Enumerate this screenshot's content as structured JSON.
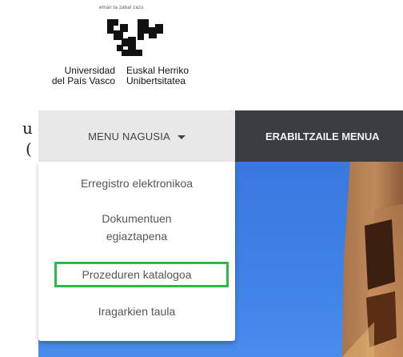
{
  "logo": {
    "tagline": "eman ta zabal zazu",
    "name_es": [
      "Universidad",
      "del País Vasco"
    ],
    "name_eu": [
      "Euskal Herriko",
      "Unibertsitatea"
    ]
  },
  "background_text": [
    "u",
    "("
  ],
  "nav": {
    "main_menu_label": "MENU NAGUSIA",
    "user_menu_label": "ERABILTZAILE MENUA"
  },
  "dropdown": {
    "items": [
      {
        "label": "Erregistro elektronikoa"
      },
      {
        "label_lines": [
          "Dokumentuen",
          "egiaztapena"
        ]
      },
      {
        "label": "Prozeduren katalogoa",
        "highlighted": true
      },
      {
        "label": "Iragarkien taula"
      }
    ]
  },
  "colors": {
    "navbar": "#3a3d42",
    "main_menu_bg": "#e8e8e8",
    "hero_sky": "#3b7ae2",
    "highlight": "#2db84a"
  },
  "icons": {
    "caret": "chevron-down-icon",
    "logo": "university-logo"
  }
}
